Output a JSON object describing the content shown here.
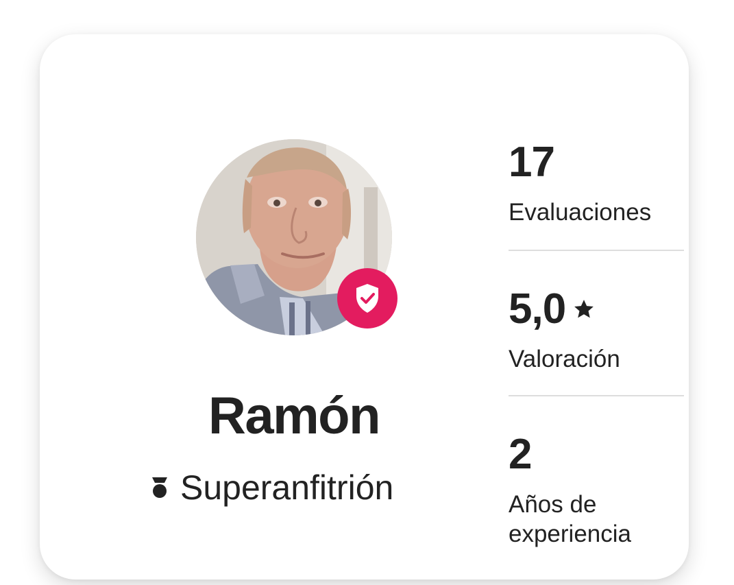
{
  "host": {
    "name": "Ramón",
    "badge_label": "Superanfitrión",
    "badge_icon": "superhost-medal-icon",
    "verified_icon": "shield-check-icon"
  },
  "stats": [
    {
      "value": "17",
      "label": "Evaluaciones"
    },
    {
      "value": "5,0",
      "label": "Valoración",
      "icon": "star-icon"
    },
    {
      "value": "2",
      "label": "Años de experiencia"
    }
  ],
  "colors": {
    "accent": "#e31c5f",
    "text": "#222222",
    "divider": "#dddddd"
  }
}
